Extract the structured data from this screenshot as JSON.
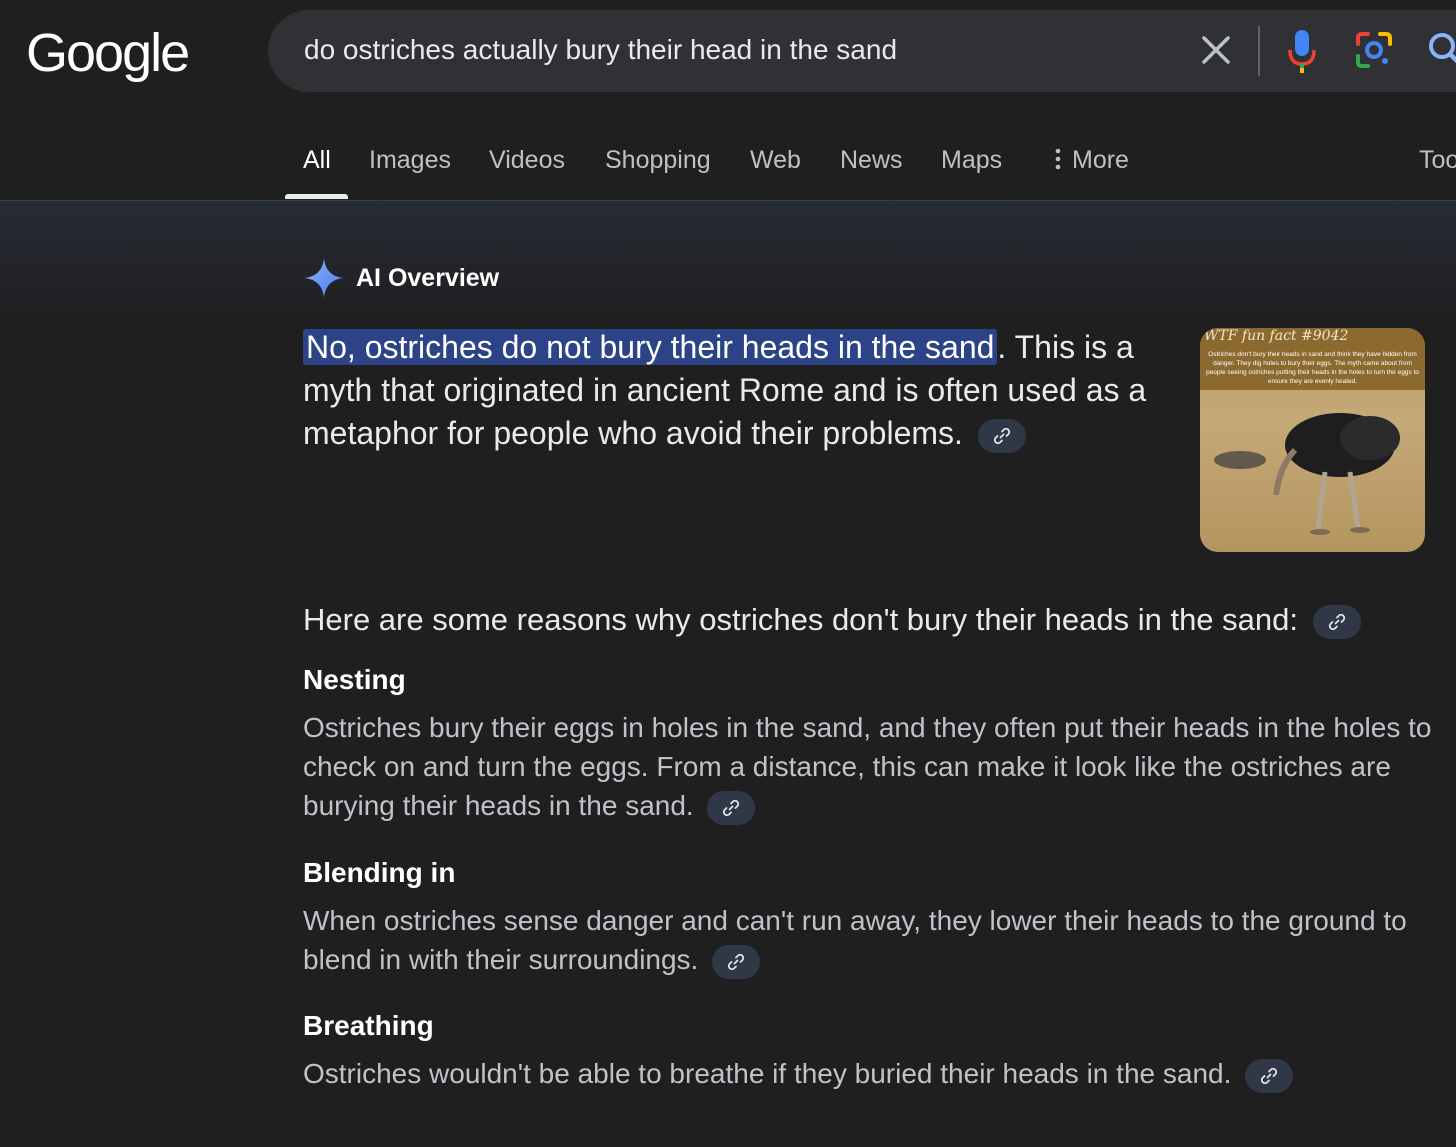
{
  "header": {
    "logo_text": "Google",
    "search_query": "do ostriches actually bury their head in the sand"
  },
  "tabs": [
    {
      "label": "All",
      "active": true
    },
    {
      "label": "Images"
    },
    {
      "label": "Videos"
    },
    {
      "label": "Shopping"
    },
    {
      "label": "Web"
    },
    {
      "label": "News"
    },
    {
      "label": "Maps"
    },
    {
      "label": "More"
    },
    {
      "label": "Too"
    }
  ],
  "ai_overview": {
    "title": "AI Overview",
    "highlight": "No, ostriches do not bury their heads in the sand",
    "summary_rest": ". This is a myth that originated in ancient Rome and is often used as a metaphor for people who avoid their problems.",
    "image": {
      "title": "WTF fun fact #9042",
      "caption": "Ostriches don't bury their heads in sand and think they have hidden from danger. They dig holes to bury their eggs. The myth came about from people seeing ostriches putting their heads in the holes to turn the eggs to ensure they are evenly heated."
    },
    "reasons_intro": "Here are some reasons why ostriches don't bury their heads in the sand:",
    "reasons": [
      {
        "title": "Nesting",
        "body": "Ostriches bury their eggs in holes in the sand, and they often put their heads in the holes to check on and turn the eggs. From a distance, this can make it look like the ostriches are burying their heads in the sand."
      },
      {
        "title": "Blending in",
        "body": "When ostriches sense danger and can't run away, they lower their heads to the ground to blend in with their surroundings."
      },
      {
        "title": "Breathing",
        "body": "Ostriches wouldn't be able to breathe if they buried their heads in the sand."
      }
    ]
  },
  "colors": {
    "background": "#1f1f1f",
    "highlight": "#2c4487",
    "link_chip": "#303747"
  }
}
